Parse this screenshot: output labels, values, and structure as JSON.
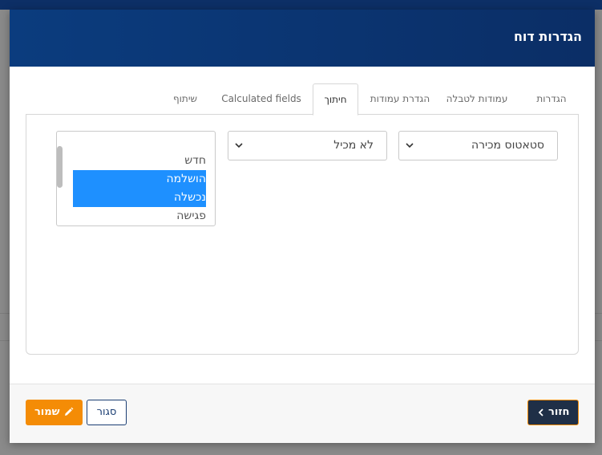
{
  "modal": {
    "title": "הגדרות דוח"
  },
  "tabs": [
    {
      "label": "הגדרות",
      "active": false
    },
    {
      "label": "עמודות לטבלה",
      "active": false
    },
    {
      "label": "הגדרת עמודות",
      "active": false
    },
    {
      "label": "חיתוך",
      "active": true
    },
    {
      "label": "Calculated fields",
      "active": false
    },
    {
      "label": "שיתוף",
      "active": false
    }
  ],
  "filter": {
    "field_select": {
      "value": "סטאטוס מכירה",
      "icon": "chevron-down-icon"
    },
    "operator_select": {
      "value": "לא מכיל",
      "icon": "chevron-down-icon"
    },
    "values_list": [
      {
        "label": "חדש",
        "selected": false
      },
      {
        "label": "הושלמה",
        "selected": true
      },
      {
        "label": "נכשלה",
        "selected": true
      },
      {
        "label": "פגישה",
        "selected": false
      }
    ]
  },
  "footer": {
    "save_label": "שמור",
    "save_icon": "pencil-icon",
    "close_label": "סגור",
    "back_label": "חזור",
    "back_icon": "chevron-left-icon"
  },
  "colors": {
    "header": "#0b3c7e",
    "selection": "#1e90ff",
    "save_button": "#f48c06",
    "back_button": "#1f2f47"
  }
}
